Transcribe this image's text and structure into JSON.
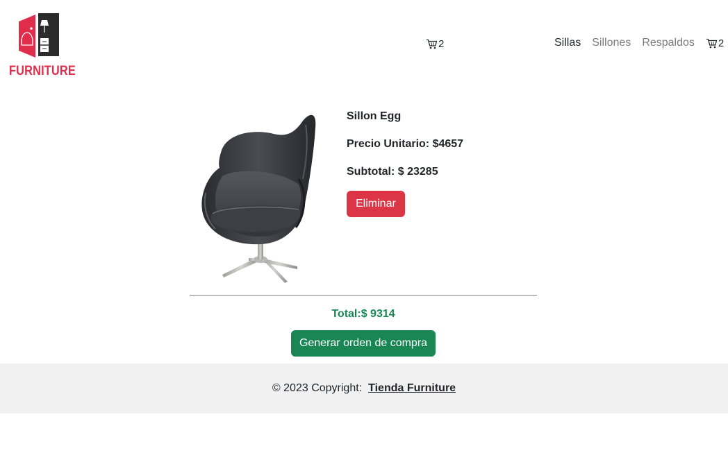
{
  "brand": {
    "name": "FURNITURE",
    "accent_color": "#e02d4b",
    "icon": "furniture-logo-icon"
  },
  "header": {
    "cart_count_mid": "2",
    "nav": [
      {
        "label": "Sillas",
        "active": true
      },
      {
        "label": "Sillones",
        "active": false
      },
      {
        "label": "Respaldos",
        "active": false
      }
    ],
    "cart_count_right": "2",
    "cart_icon": "cart-icon"
  },
  "cart_item": {
    "name": "Sillon Egg",
    "unit_price": "Precio Unitario: $4657",
    "subtotal": "Subtotal: $ 23285",
    "remove_label": "Eliminar",
    "image": "egg-chair-image"
  },
  "summary": {
    "total": "Total:$ 9314",
    "order_button": "Generar orden de compra"
  },
  "footer": {
    "copyright": "© 2023 Copyright:",
    "link": "Tienda Furniture"
  },
  "colors": {
    "danger": "#dc3545",
    "success": "#198754",
    "footer_bg": "#f1f1f1"
  }
}
